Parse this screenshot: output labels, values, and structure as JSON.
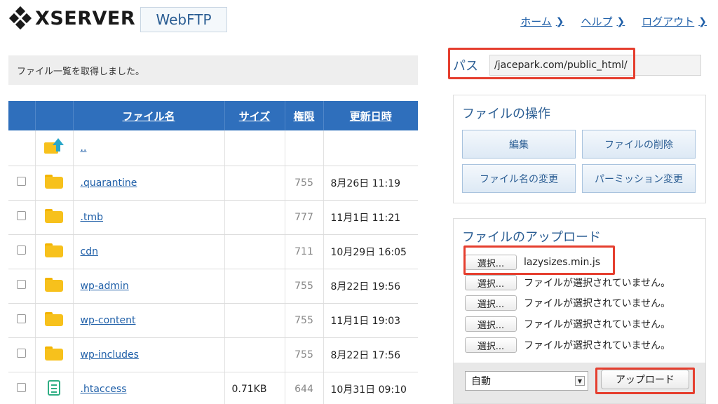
{
  "header": {
    "logo_text": "XSERVER",
    "product_name": "WebFTP",
    "nav": [
      {
        "label": "ホーム"
      },
      {
        "label": "ヘルプ"
      },
      {
        "label": "ログアウト"
      }
    ]
  },
  "status": {
    "message": "ファイル一覧を取得しました。"
  },
  "file_table": {
    "headers": {
      "name": "ファイル名",
      "size": "サイズ",
      "perm": "権限",
      "date": "更新日時"
    },
    "parent_link": "..",
    "rows": [
      {
        "name": ".quarantine",
        "size": "",
        "perm": "755",
        "date": "8月26日 11:19",
        "icon": "folder-icon"
      },
      {
        "name": ".tmb",
        "size": "",
        "perm": "777",
        "date": "11月1日 11:21",
        "icon": "folder-icon"
      },
      {
        "name": "cdn",
        "size": "",
        "perm": "711",
        "date": "10月29日 16:05",
        "icon": "folder-icon"
      },
      {
        "name": "wp-admin",
        "size": "",
        "perm": "755",
        "date": "8月22日 19:56",
        "icon": "folder-icon"
      },
      {
        "name": "wp-content",
        "size": "",
        "perm": "755",
        "date": "11月1日 19:03",
        "icon": "folder-icon"
      },
      {
        "name": "wp-includes",
        "size": "",
        "perm": "755",
        "date": "8月22日 17:56",
        "icon": "folder-icon"
      },
      {
        "name": ".htaccess",
        "size": "0.71KB",
        "perm": "644",
        "date": "10月31日 09:10",
        "icon": "document-icon"
      }
    ]
  },
  "path": {
    "label": "パス",
    "value": "/jacepark.com/public_html/"
  },
  "file_ops": {
    "title": "ファイルの操作",
    "edit": "編集",
    "delete": "ファイルの削除",
    "rename": "ファイル名の変更",
    "permission": "パーミッション変更"
  },
  "upload": {
    "title": "ファイルのアップロード",
    "select_label": "選択...",
    "files": [
      "lazysizes.min.js",
      "ファイルが選択されていません。",
      "ファイルが選択されていません。",
      "ファイルが選択されていません。",
      "ファイルが選択されていません。"
    ],
    "mode_selected": "自動",
    "upload_button": "アップロード"
  },
  "colors": {
    "accent": "#2f6fbc",
    "link": "#1f5fa8",
    "highlight": "#e53e2e",
    "folder": "#f7c11c"
  }
}
